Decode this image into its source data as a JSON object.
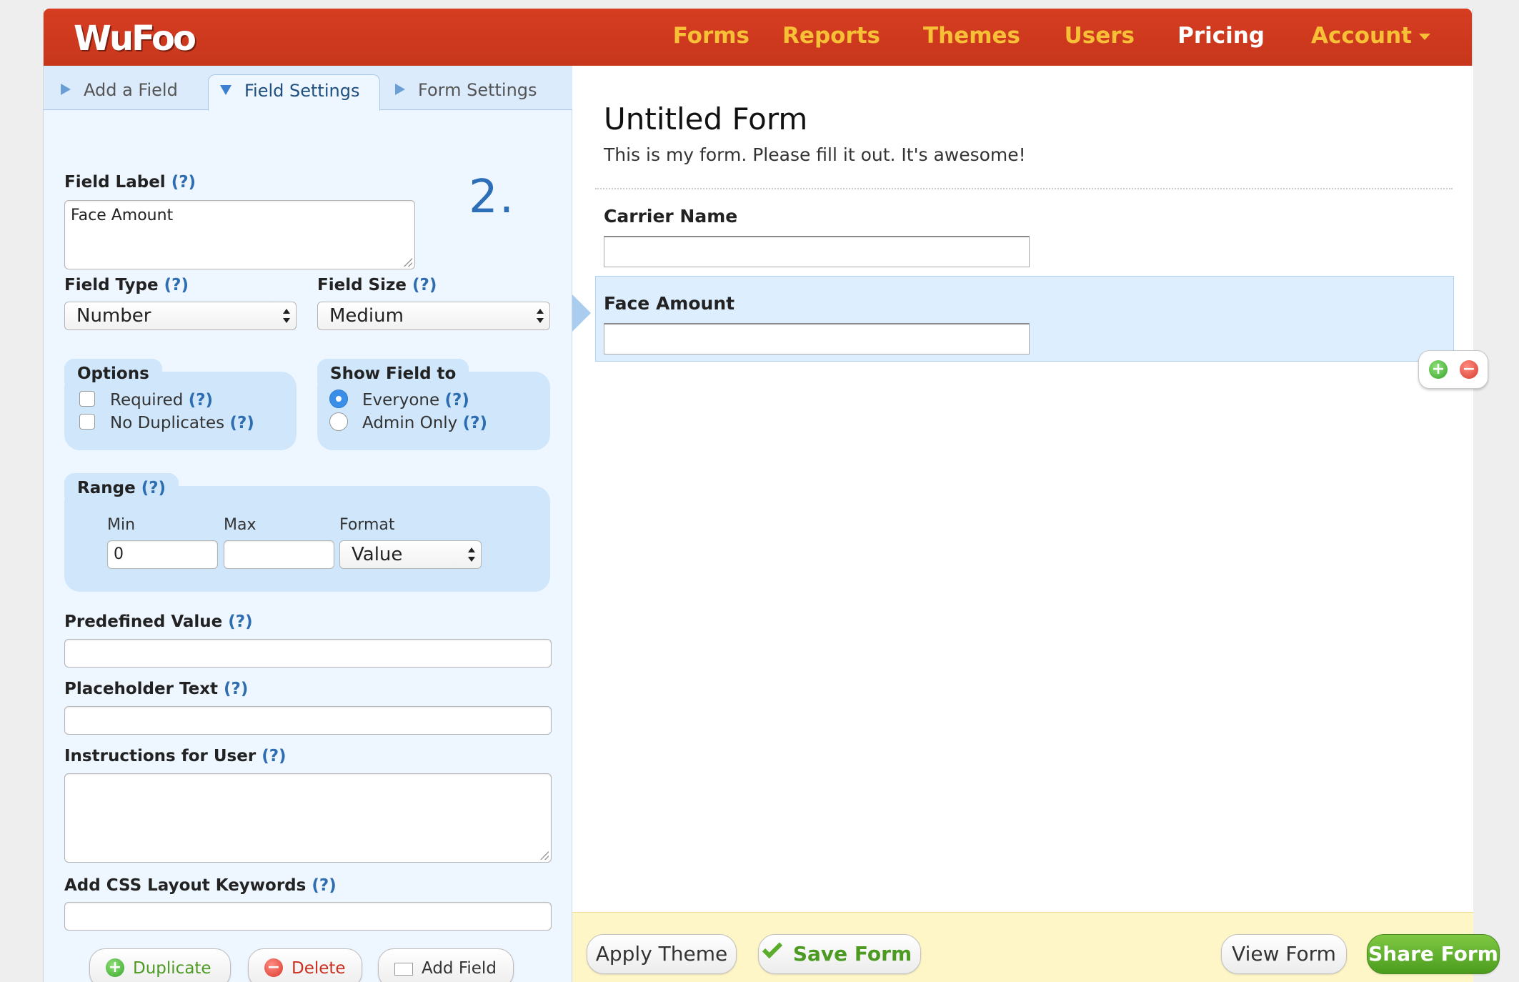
{
  "brand": {
    "logo": "WuFoo"
  },
  "nav": {
    "forms": "Forms",
    "reports": "Reports",
    "themes": "Themes",
    "users": "Users",
    "pricing": "Pricing",
    "account": "Account"
  },
  "tabs": {
    "add_field": "Add a Field",
    "field_settings": "Field Settings",
    "form_settings": "Form Settings"
  },
  "help": "(?)",
  "field_number": "2.",
  "settings": {
    "field_label_title": "Field Label",
    "field_label_value": "Face Amount",
    "field_type_title": "Field Type",
    "field_type_value": "Number",
    "field_size_title": "Field Size",
    "field_size_value": "Medium",
    "options_title": "Options",
    "options": [
      "Required",
      "No Duplicates"
    ],
    "show_field_title": "Show Field to",
    "show_field_options": [
      "Everyone",
      "Admin Only"
    ],
    "show_field_selected": "Everyone",
    "range_title": "Range",
    "range_min_label": "Min",
    "range_max_label": "Max",
    "range_format_label": "Format",
    "range_min_value": "0",
    "range_max_value": "",
    "range_format_value": "Value",
    "predefined_title": "Predefined Value",
    "placeholder_title": "Placeholder Text",
    "instructions_title": "Instructions for User",
    "css_title": "Add CSS Layout Keywords"
  },
  "actions": {
    "duplicate": "Duplicate",
    "delete": "Delete",
    "add_field": "Add Field"
  },
  "form": {
    "title": "Untitled Form",
    "description": "This is my form. Please fill it out. It's awesome!",
    "fields": [
      "Carrier Name",
      "Face Amount"
    ]
  },
  "footer": {
    "apply_theme": "Apply Theme",
    "save_form": "Save Form",
    "view_form": "View Form",
    "share_form": "Share Form"
  },
  "colors": {
    "header": "#d03a1f",
    "nav": "#f8c036",
    "panel": "#eef6ff",
    "box": "#cfe6fb",
    "link": "#2e6db0",
    "share": "#5fae2c"
  }
}
